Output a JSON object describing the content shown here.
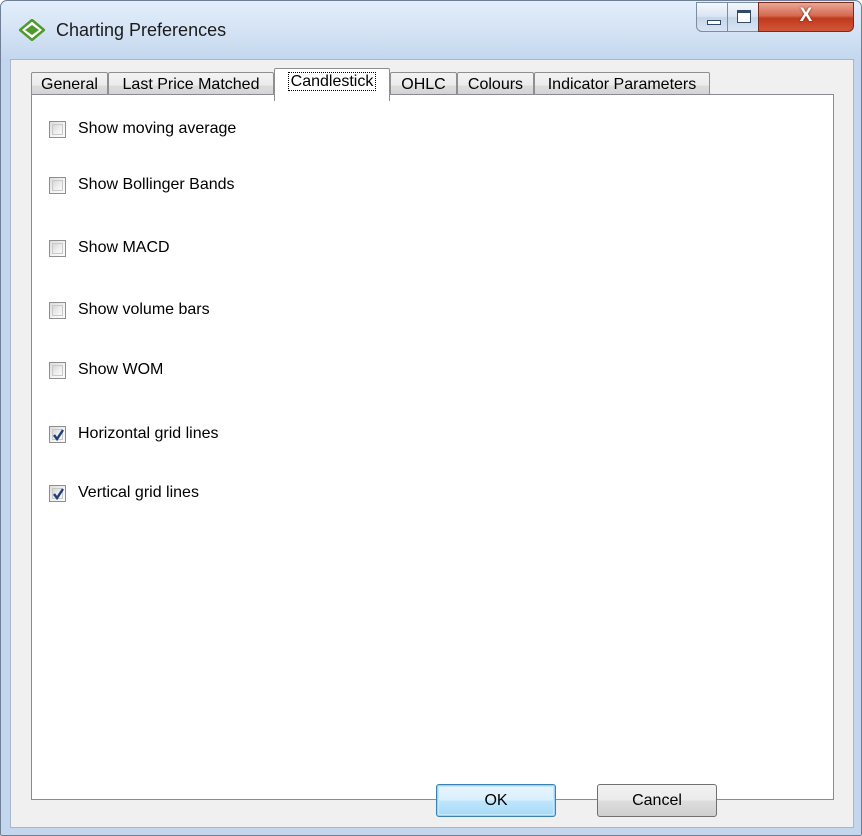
{
  "window": {
    "title": "Charting Preferences",
    "icon": "diamond-app-icon",
    "controls": {
      "minimize": "minimize-icon",
      "maximize": "maximize-icon",
      "close_glyph": "X"
    }
  },
  "tabs": [
    {
      "label": "General",
      "active": false
    },
    {
      "label": "Last Price Matched",
      "active": false
    },
    {
      "label": "Candlestick",
      "active": true
    },
    {
      "label": "OHLC",
      "active": false
    },
    {
      "label": "Colours",
      "active": false
    },
    {
      "label": "Indicator Parameters",
      "active": false
    }
  ],
  "options": [
    {
      "label": "Show moving average",
      "checked": false
    },
    {
      "label": "Show Bollinger Bands",
      "checked": false
    },
    {
      "label": "Show MACD",
      "checked": false
    },
    {
      "label": "Show volume bars",
      "checked": false
    },
    {
      "label": "Show WOM",
      "checked": false
    },
    {
      "label": "Horizontal grid lines",
      "checked": true
    },
    {
      "label": "Vertical grid lines",
      "checked": true
    }
  ],
  "buttons": {
    "ok_label": "OK",
    "cancel_label": "Cancel"
  },
  "colors": {
    "accent": "#3c7fb1",
    "checkmark": "#1f3e7a",
    "icon_green": "#4f9a2d"
  }
}
